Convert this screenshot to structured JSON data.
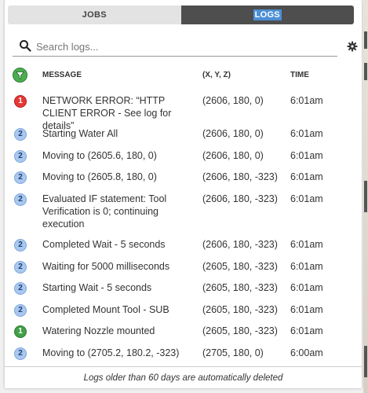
{
  "tabs": {
    "jobs": "JOBS",
    "logs": "LOGS"
  },
  "search": {
    "placeholder": "Search logs..."
  },
  "table": {
    "headers": {
      "message": "MESSAGE",
      "xyz": "(X, Y, Z)",
      "time": "TIME"
    },
    "rows": [
      {
        "badge": "1",
        "level": "error",
        "message": "NETWORK ERROR: “HTTP CLIENT ERROR - See log for details”",
        "xyz": "(2606, 180, 0)",
        "time": "6:01am"
      },
      {
        "badge": "2",
        "level": "info",
        "message": "Starting Water All",
        "xyz": "(2606, 180, 0)",
        "time": "6:01am"
      },
      {
        "badge": "2",
        "level": "info",
        "message": "Moving to (2605.6, 180, 0)",
        "xyz": "(2606, 180, 0)",
        "time": "6:01am"
      },
      {
        "badge": "2",
        "level": "info",
        "message": "Moving to (2605.8, 180, 0)",
        "xyz": "(2606, 180, -323)",
        "time": "6:01am"
      },
      {
        "badge": "2",
        "level": "info",
        "message": "Evaluated IF statement: Tool Verification is 0; continuing execution",
        "xyz": "(2606, 180, -323)",
        "time": "6:01am"
      },
      {
        "badge": "2",
        "level": "info",
        "message": "Completed Wait - 5 seconds",
        "xyz": "(2606, 180, -323)",
        "time": "6:01am"
      },
      {
        "badge": "2",
        "level": "info",
        "message": "Waiting for 5000 milliseconds",
        "xyz": "(2605, 180, -323)",
        "time": "6:01am"
      },
      {
        "badge": "2",
        "level": "info",
        "message": "Starting Wait - 5 seconds",
        "xyz": "(2605, 180, -323)",
        "time": "6:01am"
      },
      {
        "badge": "2",
        "level": "info",
        "message": "Completed Mount Tool - SUB",
        "xyz": "(2605, 180, -323)",
        "time": "6:01am"
      },
      {
        "badge": "1",
        "level": "success",
        "message": "Watering Nozzle mounted",
        "xyz": "(2605, 180, -323)",
        "time": "6:01am"
      },
      {
        "badge": "2",
        "level": "info",
        "message": "Moving to (2705.2, 180.2, -323)",
        "xyz": "(2705, 180, 0)",
        "time": "6:00am"
      }
    ]
  },
  "footer": {
    "note": "Logs older than 60 days are automatically deleted"
  },
  "colors": {
    "error": "#e53935",
    "success": "#43a047",
    "info": "#a9c8f0",
    "active_tab": "#4e4e4e"
  }
}
